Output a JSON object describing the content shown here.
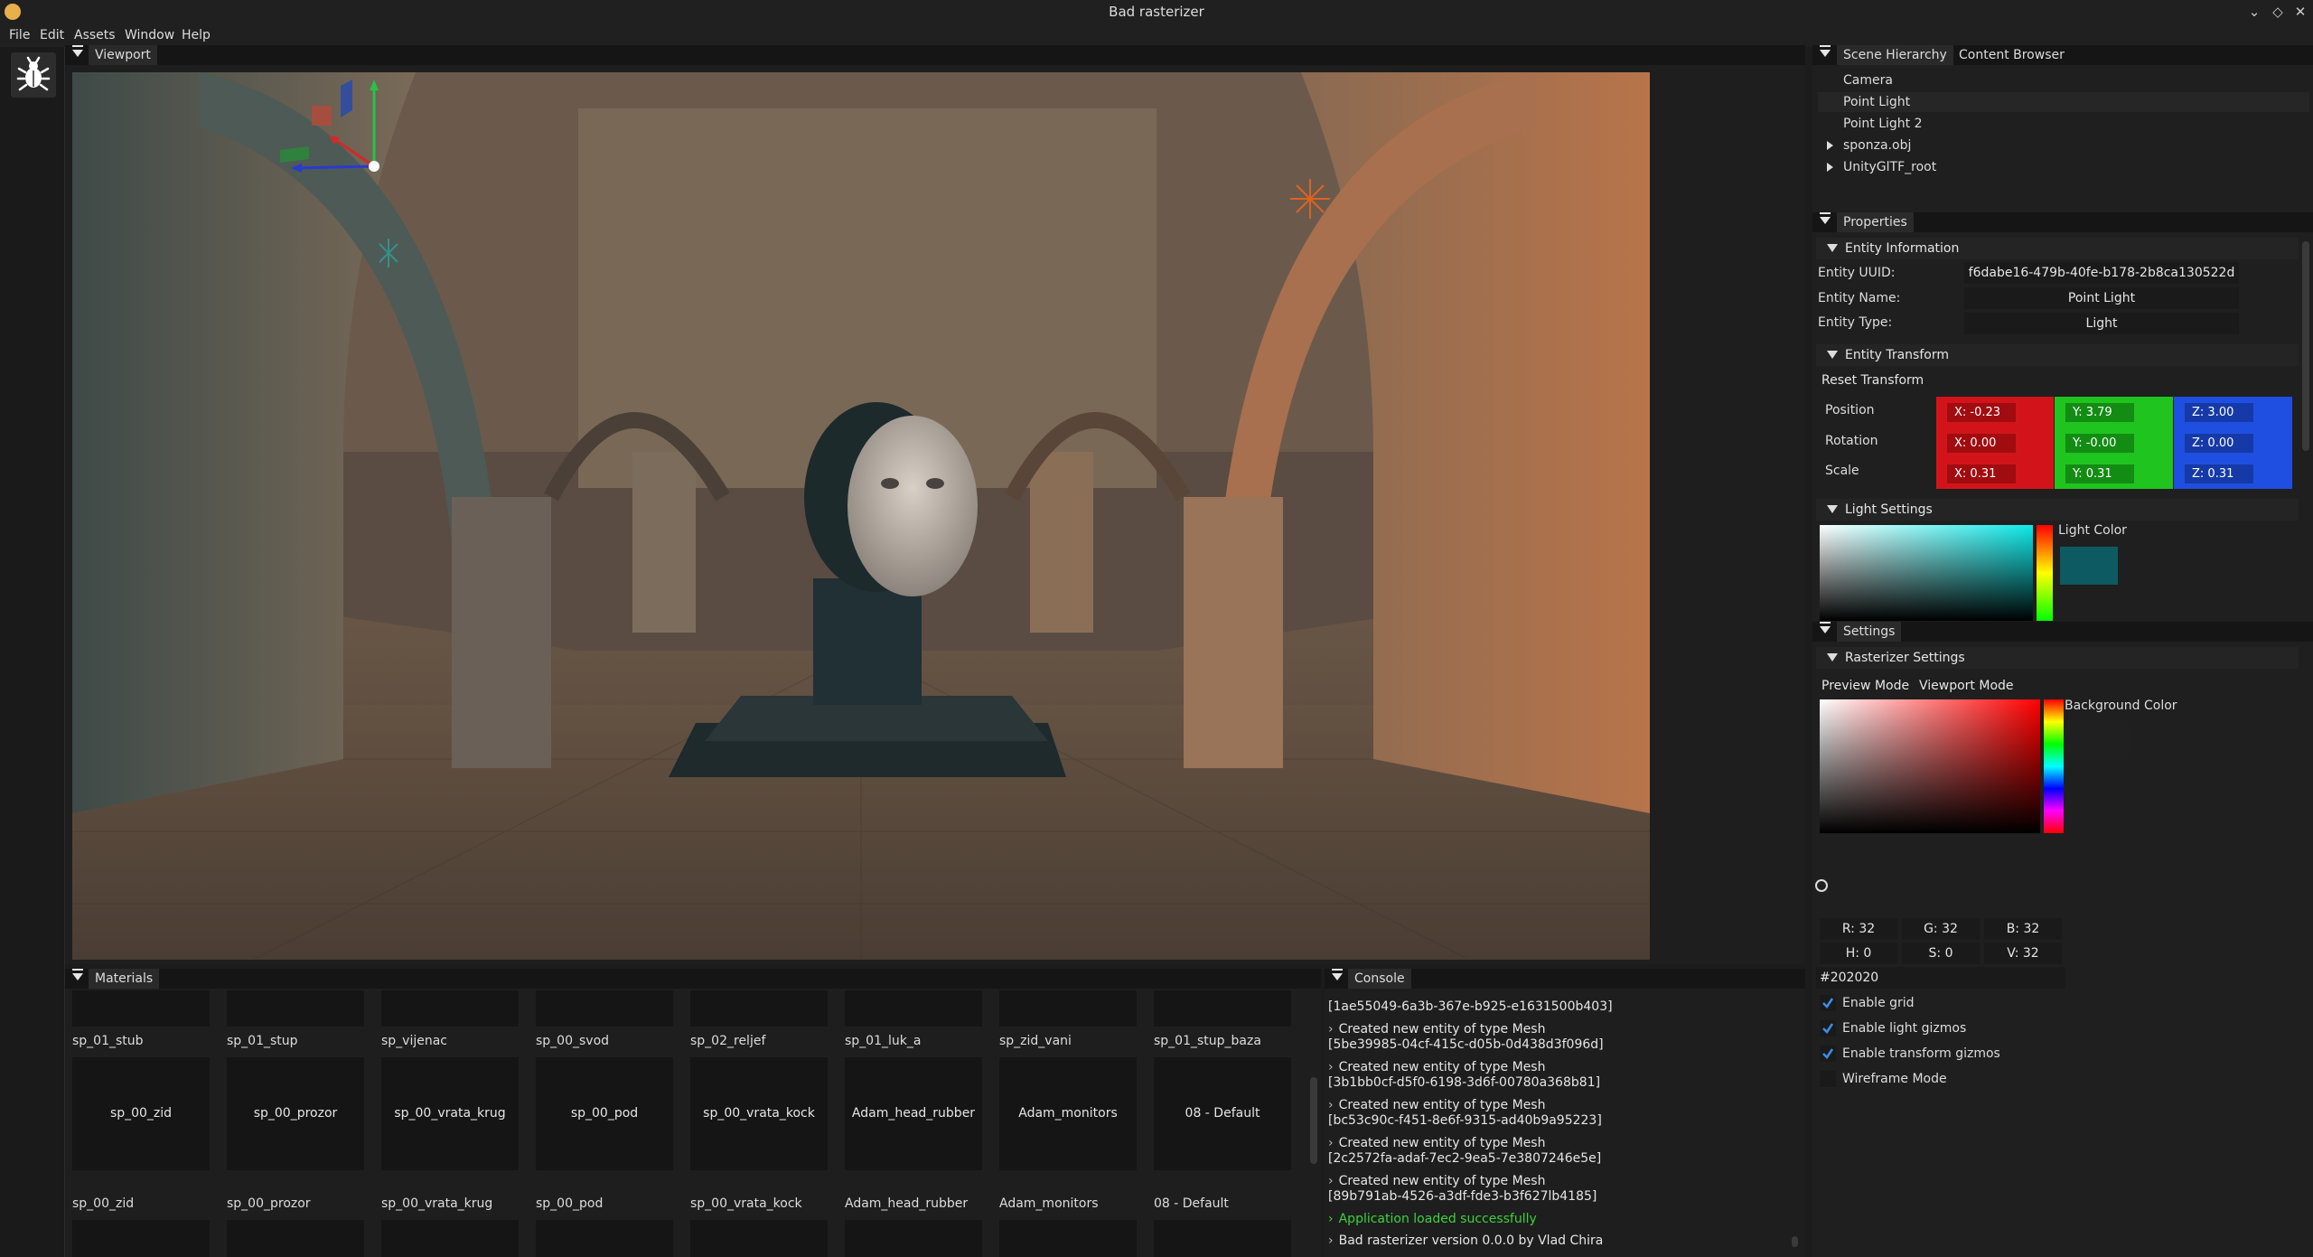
{
  "window": {
    "title": "Bad rasterizer",
    "controls": [
      "⌄",
      "◇",
      "✕"
    ]
  },
  "menubar": {
    "items": [
      "File",
      "Edit",
      "Assets",
      "Window",
      "Help"
    ]
  },
  "toolbar": {
    "debug_icon": "bug-icon"
  },
  "viewport": {
    "tab_label": "Viewport"
  },
  "hierarchy": {
    "tabs": [
      "Scene Hierarchy",
      "Content Browser"
    ],
    "items": [
      {
        "label": "Camera",
        "expandable": false
      },
      {
        "label": "Point Light",
        "expandable": false,
        "selected": true
      },
      {
        "label": "Point Light 2",
        "expandable": false
      },
      {
        "label": "sponza.obj",
        "expandable": true
      },
      {
        "label": "UnityGlTF_root",
        "expandable": true
      }
    ]
  },
  "properties": {
    "tab_label": "Properties",
    "entity_info": {
      "section_label": "Entity Information",
      "uuid_label": "Entity UUID:",
      "uuid_value": "f6dabe16-479b-40fe-b178-2b8ca130522d",
      "name_label": "Entity Name:",
      "name_value": "Point Light",
      "type_label": "Entity Type:",
      "type_value": "Light"
    },
    "transform": {
      "section_label": "Entity Transform",
      "reset_label": "Reset Transform",
      "rows": [
        {
          "label": "Position",
          "x": "X: -0.23",
          "y": "Y: 3.79",
          "z": "Z: 3.00"
        },
        {
          "label": "Rotation",
          "x": "X: 0.00",
          "y": "Y: -0.00",
          "z": "Z: 0.00"
        },
        {
          "label": "Scale",
          "x": "X: 0.31",
          "y": "Y: 0.31",
          "z": "Z: 0.31"
        }
      ]
    },
    "light": {
      "section_label": "Light Settings",
      "color_label": "Light Color",
      "color_hex": "#0e5a62"
    }
  },
  "settings": {
    "tab_label": "Settings",
    "section_label": "Rasterizer Settings",
    "buttons": [
      "Preview Mode",
      "Viewport Mode"
    ],
    "bg_label": "Background Color",
    "rgb": {
      "r": "R: 32",
      "g": "G: 32",
      "b": "B: 32"
    },
    "hsv": {
      "h": "H:  0",
      "s": "S:  0",
      "v": "V: 32"
    },
    "hex": "#202020",
    "checkboxes": [
      {
        "label": "Enable grid",
        "checked": true
      },
      {
        "label": "Enable light gizmos",
        "checked": true
      },
      {
        "label": "Enable transform gizmos",
        "checked": true
      },
      {
        "label": "Wireframe Mode",
        "checked": false
      }
    ]
  },
  "materials": {
    "tab_label": "Materials",
    "row_top_labels": [
      "sp_01_stub",
      "sp_01_stup",
      "sp_vijenac",
      "sp_00_svod",
      "sp_02_reljef",
      "sp_01_luk_a",
      "sp_zid_vani",
      "sp_01_stup_baza"
    ],
    "row_mid": [
      "sp_00_zid",
      "sp_00_prozor",
      "sp_00_vrata_krug",
      "sp_00_pod",
      "sp_00_vrata_kock",
      "Adam_head_rubber",
      "Adam_monitors",
      "08 - Default"
    ]
  },
  "console": {
    "tab_label": "Console",
    "lines": [
      {
        "text": "[1ae55049-6a3b-367e-b925-e1631500b403]",
        "arrow": false,
        "green": false
      },
      {
        "text": "Created new entity of type Mesh",
        "arrow": true,
        "green": false
      },
      {
        "text": "[5be39985-04cf-415c-d05b-0d438d3f096d]",
        "arrow": false,
        "green": false
      },
      {
        "text": "Created new entity of type Mesh",
        "arrow": true,
        "green": false
      },
      {
        "text": "[3b1bb0cf-d5f0-6198-3d6f-00780a368b81]",
        "arrow": false,
        "green": false
      },
      {
        "text": "Created new entity of type Mesh",
        "arrow": true,
        "green": false
      },
      {
        "text": "[bc53c90c-f451-8e6f-9315-ad40b9a95223]",
        "arrow": false,
        "green": false
      },
      {
        "text": "Created new entity of type Mesh",
        "arrow": true,
        "green": false
      },
      {
        "text": "[2c2572fa-adaf-7ec2-9ea5-7e3807246e5e]",
        "arrow": false,
        "green": false
      },
      {
        "text": "Created new entity of type Mesh",
        "arrow": true,
        "green": false
      },
      {
        "text": "[89b791ab-4526-a3df-fde3-b3f627lb4185]",
        "arrow": false,
        "green": false
      },
      {
        "text": "Application loaded successfully",
        "arrow": true,
        "green": true
      },
      {
        "text": "Bad rasterizer version 0.0.0 by Vlad Chira",
        "arrow": true,
        "green": false
      }
    ]
  }
}
